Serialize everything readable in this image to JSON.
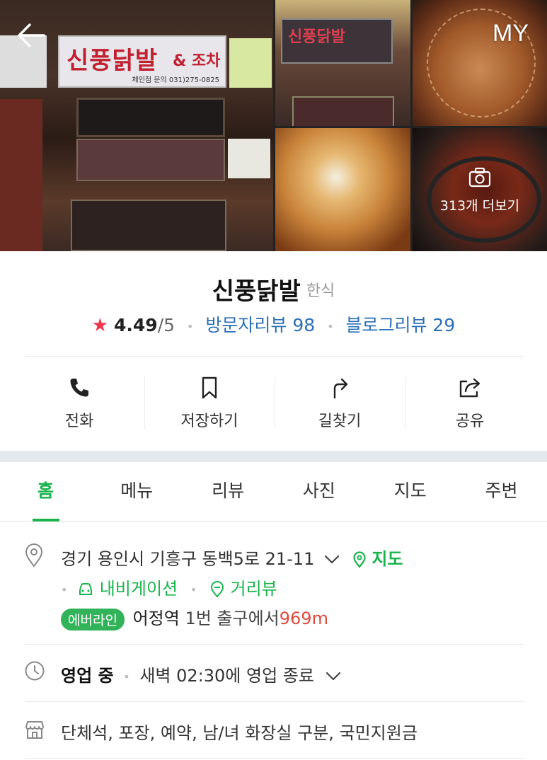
{
  "gallery": {
    "storefront_sign": "신풍닭발",
    "storefront_sign_extra": "& 조차",
    "storefront_phone": "체인점 문의 031)275-0825",
    "more_photos_label": "313개 더보기"
  },
  "header": {
    "back_icon": "arrow-left-icon",
    "my_label": "MY"
  },
  "place": {
    "name": "신풍닭발",
    "category": "한식",
    "rating": "4.49",
    "rating_scale": "/5",
    "visitor_reviews": "방문자리뷰 98",
    "blog_reviews": "블로그리뷰 29"
  },
  "actions": [
    {
      "icon": "phone-icon",
      "label": "전화"
    },
    {
      "icon": "bookmark-icon",
      "label": "저장하기"
    },
    {
      "icon": "directions-icon",
      "label": "길찾기"
    },
    {
      "icon": "share-icon",
      "label": "공유"
    }
  ],
  "tabs": [
    {
      "label": "홈",
      "active": true
    },
    {
      "label": "메뉴",
      "active": false
    },
    {
      "label": "리뷰",
      "active": false
    },
    {
      "label": "사진",
      "active": false
    },
    {
      "label": "지도",
      "active": false
    },
    {
      "label": "주변",
      "active": false
    }
  ],
  "address": {
    "text": "경기 용인시 기흥구 동백5로 21-11",
    "map_link": "지도",
    "navigation_link": "내비게이션",
    "streetview_link": "거리뷰",
    "line_badge": "에버라인",
    "station": "어정역",
    "exit_text": "1번 출구에서",
    "distance": "969m"
  },
  "hours": {
    "status": "영업 중",
    "detail": "새벽 02:30에 영업 종료"
  },
  "amenities": {
    "text": "단체석, 포장, 예약, 남/녀 화장실 구분, 국민지원금"
  },
  "colors": {
    "accent_green": "#19b44c",
    "link_blue": "#2a6fb8",
    "star_red": "#f0344a",
    "distance_red": "#e04a3a"
  }
}
